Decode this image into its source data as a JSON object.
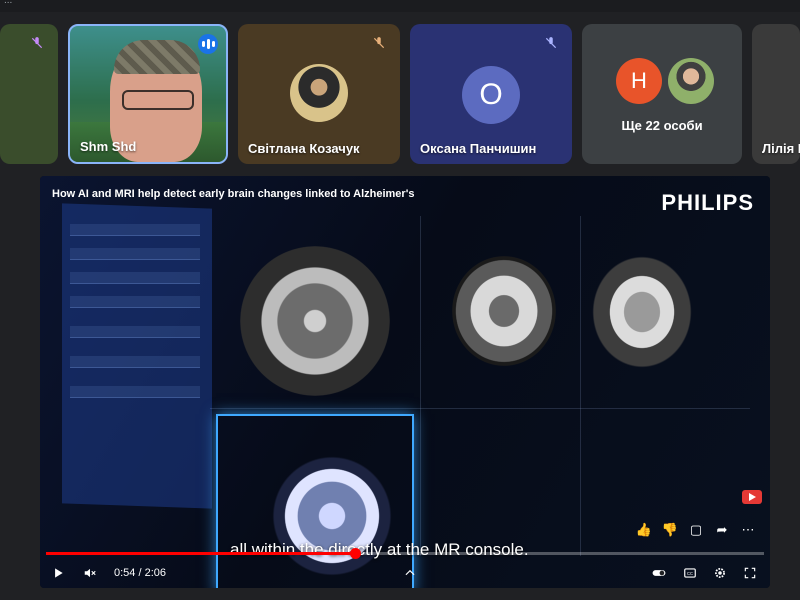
{
  "window": {
    "title_fragment": "..."
  },
  "participants": [
    {
      "name": "",
      "muted": true
    },
    {
      "name": "Shm Shd",
      "speaking": true
    },
    {
      "name": "Світлана Козачук",
      "muted": true
    },
    {
      "name": "Оксана Панчишин",
      "initial": "O",
      "muted": true
    },
    {
      "name": "Лілія М"
    }
  ],
  "overflow": {
    "initial": "H",
    "label": "Ще 22 особи"
  },
  "video": {
    "title": "How AI and MRI help detect early brain changes linked to Alzheimer's",
    "brand": "PHILIPS",
    "caption": "all within the directly at the MR console.",
    "current_time": "0:54",
    "duration": "2:06",
    "time_display": "0:54 / 2:06",
    "progress": 0.43
  },
  "colors": {
    "accent": "#8ab4f8",
    "progress": "#ff0000",
    "muted_icon": "#5f6368"
  },
  "icons": {
    "muted": "mic-off-icon",
    "speaking": "speaking-indicator-icon",
    "play": "play-icon",
    "volume": "volume-muted-icon",
    "chevron": "chevron-up-icon",
    "toggle": "autoplay-toggle-icon",
    "cc": "captions-icon",
    "settings": "gear-icon",
    "fullscreen": "fullscreen-icon"
  }
}
